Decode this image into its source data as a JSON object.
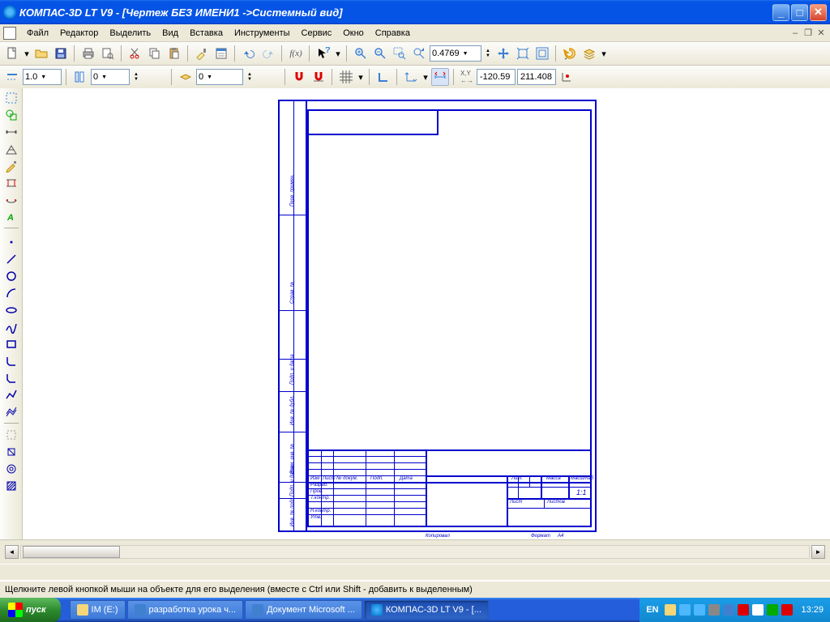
{
  "window": {
    "title": "КОМПАС-3D LT V9 - [Чертеж БЕЗ ИМЕНИ1 ->Системный вид]"
  },
  "menu": {
    "items": [
      "Файл",
      "Редактор",
      "Выделить",
      "Вид",
      "Вставка",
      "Инструменты",
      "Сервис",
      "Окно",
      "Справка"
    ]
  },
  "toolbar1": {
    "new_icon": "new",
    "open_icon": "open",
    "save_icon": "save",
    "print_icon": "print",
    "preview_icon": "preview",
    "cut_icon": "cut",
    "copy_icon": "copy",
    "paste_icon": "paste",
    "copyprops_icon": "copyprops",
    "props_icon": "props",
    "undo_icon": "undo",
    "redo_icon": "redo",
    "fx_label": "f(x)",
    "help_icon": "help",
    "arrow_icon": "arrow",
    "zoomin_icon": "zoom-in",
    "zoomout_icon": "zoom-out",
    "zoomwin_icon": "zoom-window",
    "zoomdyn_icon": "zoom-dyn",
    "zoom_value": "0.4769",
    "pan_icon": "pan",
    "zoomfit_icon": "zoom-fit",
    "zoomall_icon": "zoom-all",
    "redraw_icon": "redraw",
    "layers_icon": "layers"
  },
  "toolbar2": {
    "style_value": "1.0",
    "step_value": "0",
    "layer_value": "0",
    "snap_icon": "snap",
    "mag_icon": "magnet",
    "grid_icon": "grid",
    "ortho_icon": "ortho",
    "local_icon": "local-cs",
    "param_icon": "param",
    "xy_icon": "xy",
    "coord_x": "-120.59",
    "coord_y": "211.408"
  },
  "left_tools": {
    "group1": [
      "select-rect",
      "select-poly",
      "geom-line",
      "geom-rect",
      "geom-curve",
      "dimension",
      "text",
      "hatch"
    ],
    "group2": [
      "arc",
      "circle",
      "spline",
      "bezier",
      "fillet",
      "chamfer",
      "tangent",
      "equidist",
      "contour",
      "break",
      "trim"
    ],
    "group3": [
      "phantom",
      "aux",
      "table",
      "macro"
    ]
  },
  "stamp": {
    "izm": "Изм",
    "list": "Лист",
    "ndok": "№ докум.",
    "podp": "Подп.",
    "data": "Дата",
    "razrab": "Разраб.",
    "prov": "Пров.",
    "tkontr": "Т.контр.",
    "nkontr": "Н.контр.",
    "utv": "Утв.",
    "lit": "Лит.",
    "massa": "Масса",
    "masshtab": "Масштаб",
    "ratio": "1:1",
    "list2": "Лист",
    "listov": "Листов",
    "kopiroval": "Копировал",
    "format": "Формат",
    "a4": "А4",
    "inv1": "Инв. № подл.",
    "podp_data": "Подп. и дата",
    "vzam": "Взам. инв. №",
    "inv_dubl": "Инв. № дубл.",
    "podp_data2": "Подп. и дата",
    "perv": "Перв. примен.",
    "sprav": "Справ. №"
  },
  "status": {
    "text": "Щелкните левой кнопкой мыши на объекте для его выделения (вместе с Ctrl или Shift - добавить к выделенным)"
  },
  "taskbar": {
    "start": "пуск",
    "tasks": [
      {
        "label": "IM (E:)",
        "active": false
      },
      {
        "label": "разработка урока ч...",
        "active": false
      },
      {
        "label": "Документ Microsoft ...",
        "active": false
      },
      {
        "label": "КОМПАС-3D LT V9 - [...",
        "active": true
      }
    ],
    "lang": "EN",
    "clock": "13:29"
  }
}
